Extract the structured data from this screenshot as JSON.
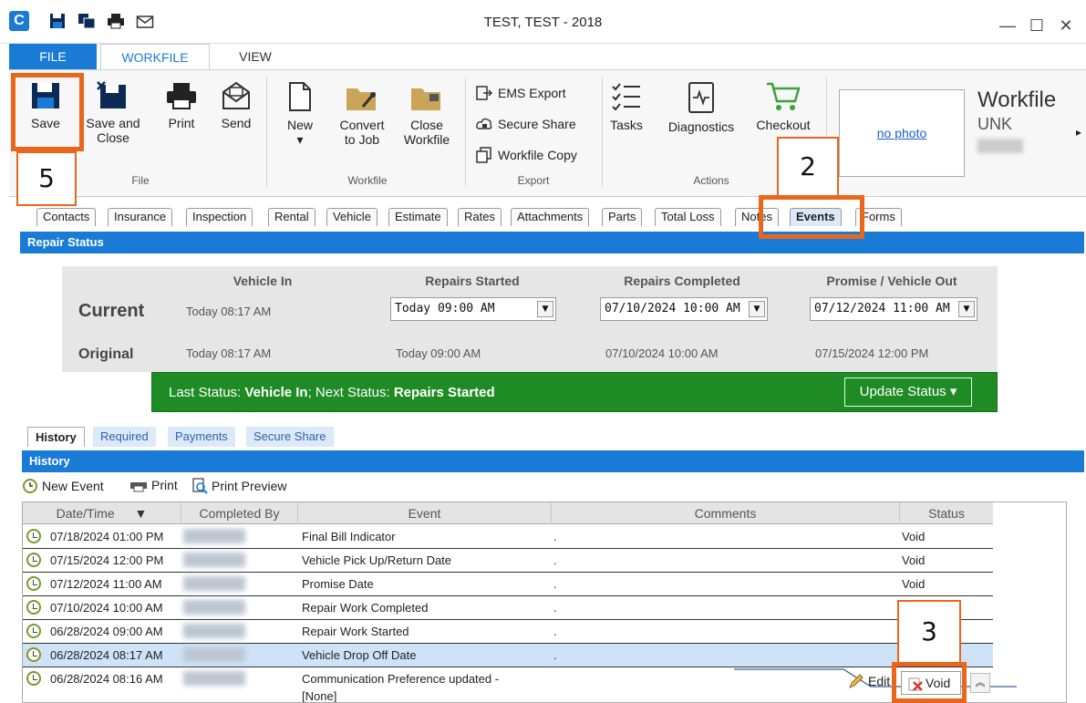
{
  "window": {
    "title": "TEST, TEST - 2018",
    "minimize": "—",
    "maximize": "☐",
    "close": "✕"
  },
  "menu_tabs": {
    "file": "FILE",
    "workfile": "WORKFILE",
    "view": "VIEW"
  },
  "ribbon": {
    "save": "Save",
    "save_close_1": "Save and",
    "save_close_2": "Close",
    "print": "Print",
    "send": "Send",
    "file_group": "File",
    "new": "New",
    "convert_1": "Convert",
    "convert_2": "to Job",
    "close_wf_1": "Close",
    "close_wf_2": "Workfile",
    "workfile_group": "Workfile",
    "ems_export": "EMS Export",
    "secure_share": "Secure Share",
    "workfile_copy": "Workfile Copy",
    "export_group": "Export",
    "tasks": "Tasks",
    "diagnostics": "Diagnostics",
    "checkout": "Checkout",
    "actions_group": "Actions",
    "no_photo": "no photo",
    "workfile_heading": "Workfile",
    "workfile_sub": "UNK"
  },
  "record_tabs": [
    "Contacts",
    "Insurance",
    "Inspection",
    "Rental",
    "Vehicle",
    "Estimate",
    "Rates",
    "Attachments",
    "Parts",
    "Total Loss",
    "Notes",
    "Events",
    "Forms"
  ],
  "repair_status": {
    "title": "Repair Status",
    "headers": [
      "Vehicle In",
      "Repairs Started",
      "Repairs Completed",
      "Promise / Vehicle Out"
    ],
    "current_label": "Current",
    "original_label": "Original",
    "current": [
      "Today 08:17 AM",
      "Today 09:00 AM",
      "07/10/2024 10:00 AM",
      "07/12/2024 11:00 AM"
    ],
    "original": [
      "Today 08:17 AM",
      "Today 09:00 AM",
      "07/10/2024 10:00 AM",
      "07/15/2024 12:00 PM"
    ],
    "last_status_prefix": "Last Status: ",
    "last_status": "Vehicle In",
    "next_status_prefix": "; Next Status: ",
    "next_status": "Repairs Started",
    "update_button": "Update Status ▾"
  },
  "sub_tabs": [
    "History",
    "Required",
    "Payments",
    "Secure Share"
  ],
  "history": {
    "title": "History",
    "toolbar": {
      "new_event": "New Event",
      "print": "Print",
      "print_preview": "Print Preview"
    },
    "columns": [
      "Date/Time",
      "Completed By",
      "Event",
      "Comments",
      "Status"
    ],
    "sort_indicator": "▼",
    "rows": [
      {
        "date": "07/18/2024 01:00 PM",
        "event": "Final Bill Indicator",
        "comments": ".",
        "status": "Void"
      },
      {
        "date": "07/15/2024 12:00 PM",
        "event": "Vehicle Pick Up/Return Date",
        "comments": ".",
        "status": "Void"
      },
      {
        "date": "07/12/2024 11:00 AM",
        "event": "Promise Date",
        "comments": ".",
        "status": "Void"
      },
      {
        "date": "07/10/2024 10:00 AM",
        "event": "Repair Work Completed",
        "comments": ".",
        "status": ""
      },
      {
        "date": "06/28/2024 09:00 AM",
        "event": "Repair Work Started",
        "comments": ".",
        "status": ""
      },
      {
        "date": "06/28/2024 08:17 AM",
        "event": "Vehicle Drop Off Date",
        "comments": ".",
        "status": ""
      },
      {
        "date": "06/28/2024 08:16 AM",
        "event": "Communication Preference updated -",
        "event_2": "[None]",
        "comments": "",
        "status": ""
      }
    ],
    "edit": "Edit",
    "void": "Void"
  },
  "annotations": {
    "save_step": "5",
    "events_step": "2",
    "void_step": "3"
  },
  "colors": {
    "accent": "#1a7bd6",
    "status_green": "#1f8b24",
    "annotation": "#e8671c"
  }
}
